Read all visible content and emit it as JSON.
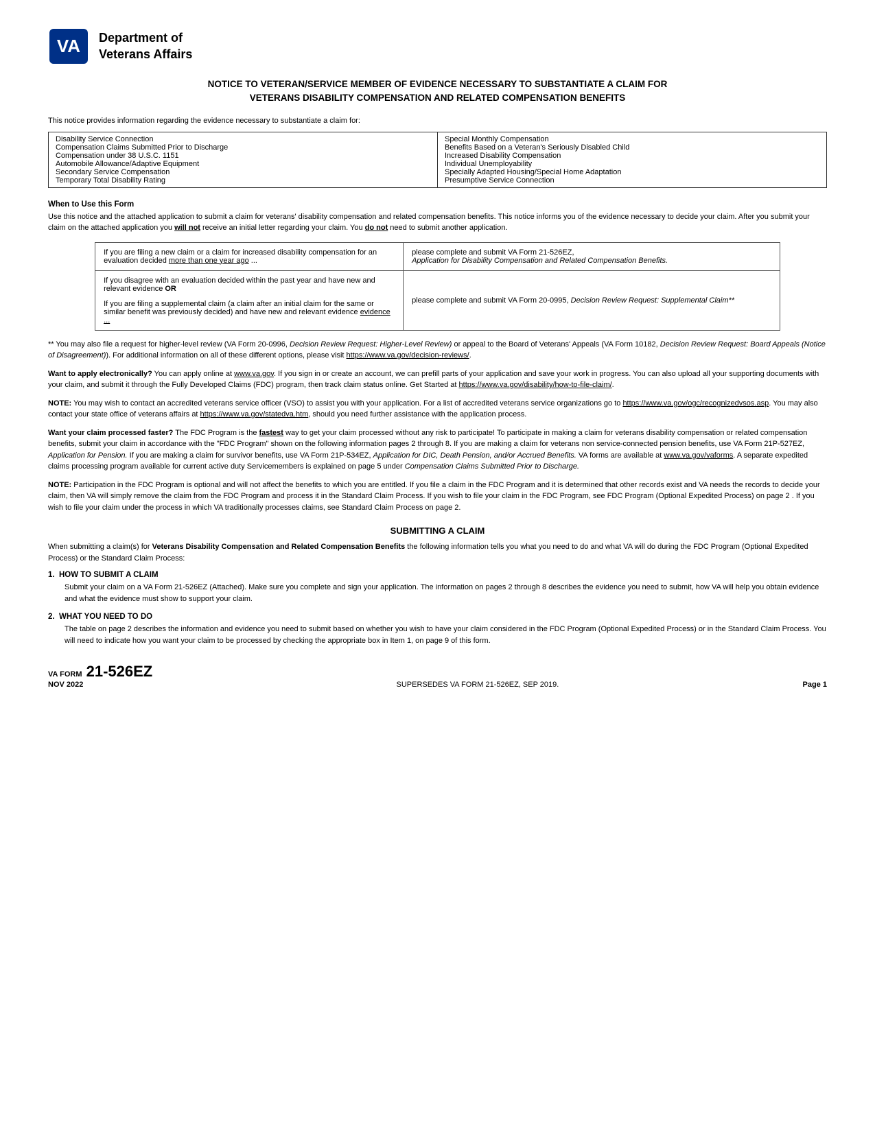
{
  "header": {
    "org_line1": "Department of",
    "org_line2": "Veterans Affairs"
  },
  "main_title": {
    "line1": "NOTICE TO VETERAN/SERVICE MEMBER OF EVIDENCE NECESSARY TO SUBSTANTIATE A CLAIM FOR",
    "line2": "VETERANS DISABILITY COMPENSATION AND RELATED COMPENSATION BENEFITS"
  },
  "intro": "This notice provides information regarding the evidence necessary to substantiate a claim for:",
  "claim_types": {
    "left": [
      "Disability Service Connection",
      "Compensation Claims Submitted Prior to Discharge",
      "Compensation under 38 U.S.C. 1151",
      "Automobile Allowance/Adaptive Equipment",
      "Secondary Service Compensation",
      "Temporary Total Disability Rating"
    ],
    "right": [
      "Special Monthly Compensation",
      "Benefits Based on a Veteran's Seriously Disabled Child",
      "Increased Disability Compensation",
      "Individual Unemployability",
      "Specially Adapted Housing/Special Home Adaptation",
      "Presumptive Service Connection"
    ]
  },
  "when_to_use_heading": "When to Use this Form",
  "when_to_use_text": "Use this notice and the attached application to submit a claim for veterans' disability compensation and related compensation benefits. This notice informs you of the evidence necessary to decide your claim. After you submit your claim on the attached application you will not receive an initial letter regarding your claim. You do not need to submit another application.",
  "instruction_rows": [
    {
      "left": "If you are filing a new claim or a claim for increased disability compensation for an evaluation decided more than one year ago ...",
      "right": "please complete and submit VA Form 21-526EZ, Application for Disability Compensation and Related Compensation Benefits."
    },
    {
      "left": "If you disagree with an evaluation decided within the past year and have new and relevant evidence OR\n\nIf you are filing a supplemental claim (a claim after an initial claim for the same or similar benefit was previously decided) and have new and relevant evidence ...",
      "right": "please complete and submit VA Form 20-0995, Decision Review Request: Supplemental Claim**"
    }
  ],
  "footnote": "** You may also file a request for higher-level review (VA Form 20-0996, Decision Review Request: Higher-Level Review) or appeal to the Board of Veterans' Appeals (VA Form 10182, Decision Review Request: Board Appeals (Notice of Disagreement)). For additional information on all of these different options, please visit https://www.va.gov/decision-reviews/.",
  "electronic_para": {
    "heading": "Want to apply electronically?",
    "text": " You can apply online at www.va.gov. If you sign in or create an account, we can prefill parts of your application and save your work in progress. You can also upload all your supporting documents with your claim, and submit it through the Fully Developed Claims (FDC) program, then track claim status online. Get Started at https://www.va.gov/disability/how-to-file-claim/."
  },
  "vso_para": {
    "heading": "NOTE:",
    "text": " You may wish to contact an accredited veterans service officer (VSO) to assist you with your application. For a list of accredited veterans service organizations go to https://www.va.gov/ogc/recognizedvsos.asp. You may also contact your state office of veterans affairs at https://www.va.gov/statedva.htm, should you need further assistance with the application process."
  },
  "faster_para": {
    "heading": "Want your claim processed faster?",
    "text": " The FDC Program is the fastest way to get your claim processed without any risk to participate! To participate in making a claim for veterans disability compensation or related compensation benefits, submit your claim in accordance with the \"FDC Program\" shown on the following information pages 2 through 8. If you are making a claim for veterans non service-connected pension benefits, use VA Form 21P-527EZ, Application for Pension. If you are making a claim for survivor benefits, use VA Form 21P-534EZ, Application for DIC, Death Pension, and/or Accrued Benefits. VA forms are available at www.va.gov/vaforms. A separate expedited claims processing program available for current active duty Servicemembers is explained on page 5 under Compensation Claims Submitted Prior to Discharge."
  },
  "fdc_note_para": {
    "heading": "NOTE:",
    "text": " Participation in the FDC Program is optional and will not affect the benefits to which you are entitled. If you file a claim in the FDC Program and it is determined that other records exist and VA needs the records to decide your claim, then VA will simply remove the claim from the FDC Program and process it in the Standard Claim Process. If you wish to file your claim in the FDC Program, see FDC Program (Optional Expedited Process) on page 2 . If you wish to file your claim under the process in which VA traditionally processes claims, see Standard Claim Process on page 2."
  },
  "submitting_heading": "SUBMITTING A CLAIM",
  "submitting_intro": "When submitting a claim(s) for Veterans Disability Compensation and Related Compensation Benefits the following information tells you what you need to do and what VA will do during the FDC Program (Optional Expedited Process) or the Standard Claim Process:",
  "sections": [
    {
      "num": "1.",
      "title": "HOW TO SUBMIT A CLAIM",
      "text": "Submit your claim on a VA Form 21-526EZ (Attached). Make sure you complete and sign your application. The information on pages 2 through 8 describes the evidence you need to submit, how VA will help you obtain evidence and what the evidence must show to support your claim."
    },
    {
      "num": "2.",
      "title": "WHAT YOU NEED TO DO",
      "text": "The table on page 2 describes the information and evidence you need to submit based on whether you wish to have your claim considered in the FDC Program (Optional Expedited Process) or in the Standard Claim Process. You will need to indicate how you want your claim to be processed by checking the appropriate box in Item 1, on page 9 of this form."
    }
  ],
  "footer": {
    "form_label": "VA FORM",
    "form_date": "NOV 2022",
    "form_number": "21-526EZ",
    "supersedes": "SUPERSEDES VA FORM 21-526EZ, SEP 2019.",
    "page": "Page 1"
  }
}
